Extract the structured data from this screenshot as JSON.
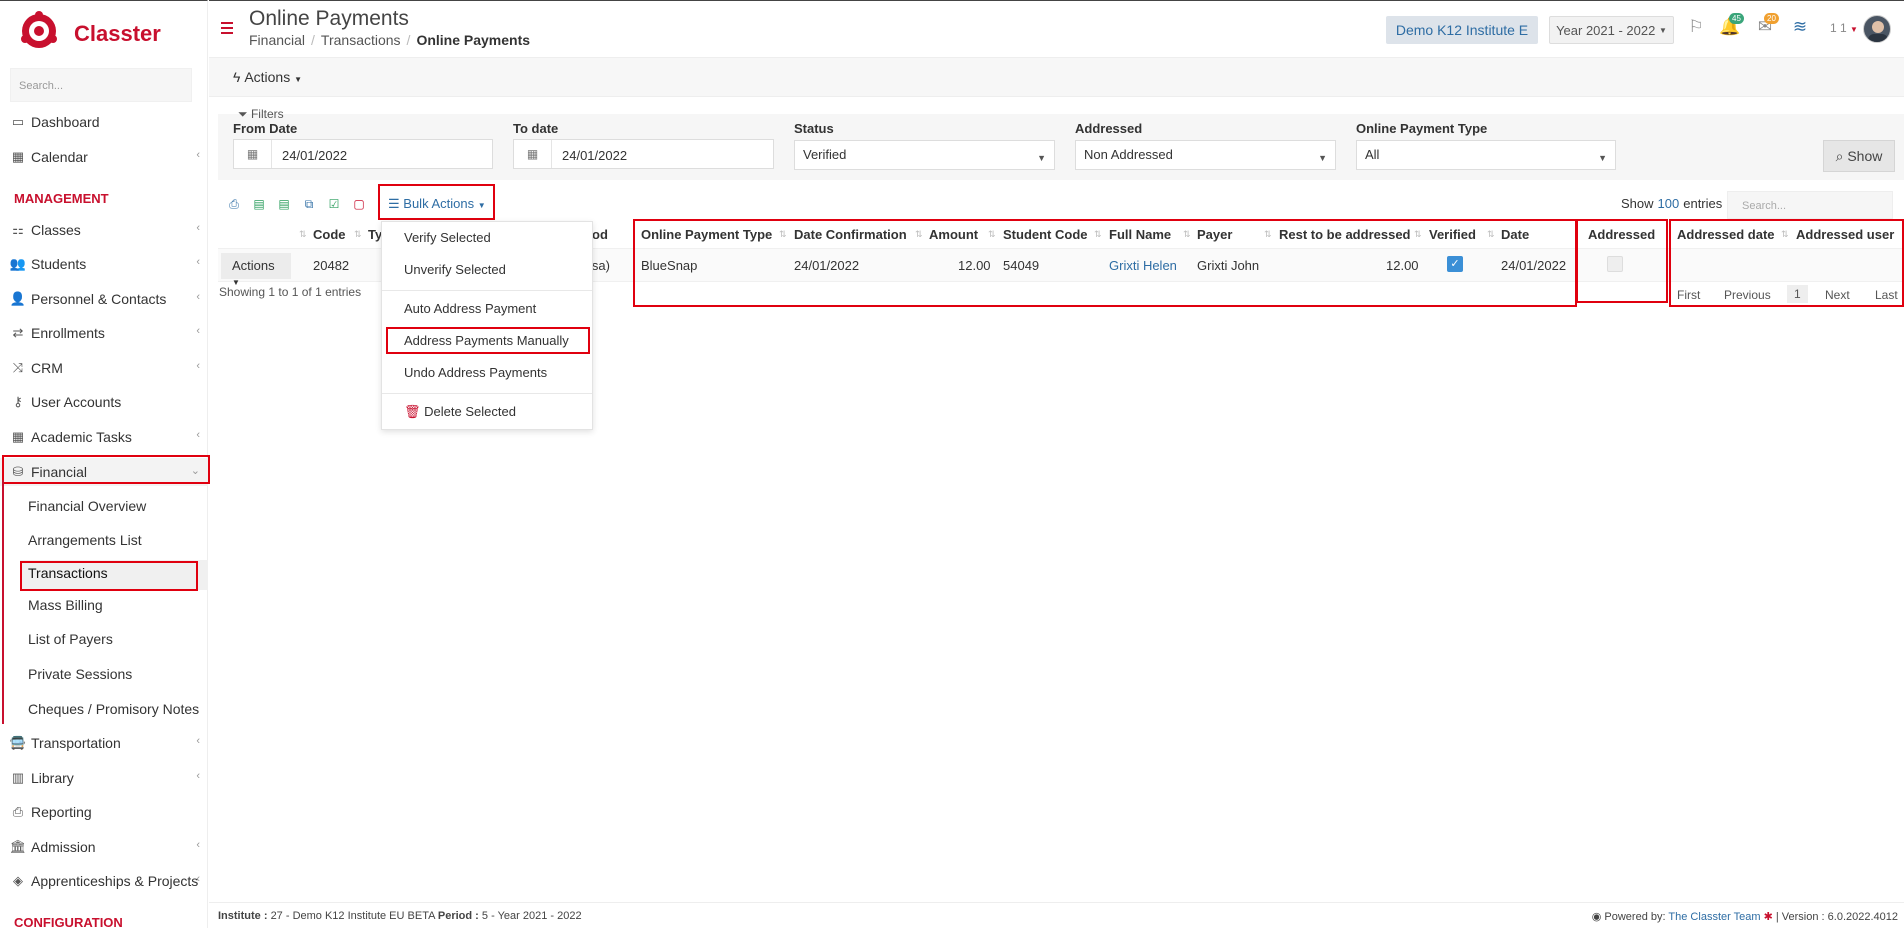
{
  "app": {
    "name": "Classter",
    "brand_color": "#c8102e",
    "accent_color": "#2e6da4"
  },
  "sidebar": {
    "search_placeholder": "Search...",
    "items": [
      {
        "label": "Dashboard",
        "icon": "laptop-icon"
      },
      {
        "label": "Calendar",
        "icon": "calendar-icon"
      },
      {
        "label": "Classes",
        "icon": "classes-icon"
      },
      {
        "label": "Students",
        "icon": "students-icon"
      },
      {
        "label": "Personnel & Contacts",
        "icon": "user-icon"
      },
      {
        "label": "Enrollments",
        "icon": "exchange-icon"
      },
      {
        "label": "CRM",
        "icon": "shuffle-icon"
      },
      {
        "label": "User Accounts",
        "icon": "key-icon"
      },
      {
        "label": "Academic Tasks",
        "icon": "grid-icon"
      },
      {
        "label": "Financial",
        "icon": "coins-icon"
      },
      {
        "label": "Transportation",
        "icon": "bus-icon"
      },
      {
        "label": "Library",
        "icon": "books-icon"
      },
      {
        "label": "Reporting",
        "icon": "printer-icon"
      },
      {
        "label": "Admission",
        "icon": "institution-icon"
      },
      {
        "label": "Apprenticeships & Projects",
        "icon": "cube-icon"
      }
    ],
    "section_management": "MANAGEMENT",
    "section_configuration": "CONFIGURATION",
    "financial_sub": [
      "Financial Overview",
      "Arrangements List",
      "Transactions",
      "Mass Billing",
      "List of Payers",
      "Private Sessions",
      "Cheques / Promisory Notes"
    ]
  },
  "header": {
    "title": "Online Payments",
    "breadcrumb": [
      "Financial",
      "Transactions",
      "Online Payments"
    ],
    "institute": "Demo K12 Institute E",
    "year": "Year 2021 - 2022",
    "notifications_count": "45",
    "messages_count": "20",
    "user_label": "1 1"
  },
  "actions_label": "Actions",
  "filters": {
    "title": "Filters",
    "from_date_label": "From Date",
    "from_date": "24/01/2022",
    "to_date_label": "To date",
    "to_date": "24/01/2022",
    "status_label": "Status",
    "status": "Verified",
    "addressed_label": "Addressed",
    "addressed": "Non Addressed",
    "type_label": "Online Payment Type",
    "type": "All",
    "show_button": "Show"
  },
  "toolbar": {
    "bulk_actions": "Bulk Actions",
    "show_label": "Show",
    "entries_count": "100",
    "entries_label": "entries",
    "search_placeholder": "Search..."
  },
  "bulk_menu": {
    "verify": "Verify Selected",
    "unverify": "Unverify Selected",
    "auto_address": "Auto Address Payment",
    "address_manually": "Address Payments Manually",
    "undo_address": "Undo Address Payments",
    "delete": "Delete Selected"
  },
  "table": {
    "headers": {
      "code": "Code",
      "ty": "Ty",
      "od": "od",
      "online_payment_type": "Online Payment Type",
      "date_confirmation": "Date Confirmation",
      "amount": "Amount",
      "student_code": "Student Code",
      "full_name": "Full Name",
      "payer": "Payer",
      "rest": "Rest to be addressed",
      "verified": "Verified",
      "date": "Date",
      "addressed": "Addressed",
      "addressed_date": "Addressed date",
      "addressed_user": "Addressed user"
    },
    "row": {
      "actions": "Actions",
      "code": "20482",
      "method_tail": "isa)",
      "online_payment_type": "BlueSnap",
      "date_confirmation": "24/01/2022",
      "amount": "12.00",
      "student_code": "54049",
      "full_name": "Grixti Helen",
      "payer": "Grixti John",
      "rest": "12.00",
      "verified": true,
      "date": "24/01/2022",
      "addressed": false
    },
    "showing": "Showing 1 to 1 of 1 entries",
    "pager": {
      "first": "First",
      "previous": "Previous",
      "page": "1",
      "next": "Next",
      "last": "Last"
    }
  },
  "footer": {
    "institute_label": "Institute :",
    "institute_value": "27 - Demo K12 Institute EU BETA",
    "period_label": "Period :",
    "period_value": "5 - Year 2021 - 2022",
    "powered_by": "Powered by:",
    "team": "The Classter Team",
    "version": "| Version : 6.0.2022.4012"
  }
}
